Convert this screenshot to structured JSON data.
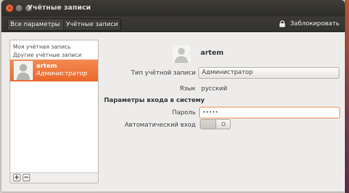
{
  "window": {
    "title": "Учётные записи"
  },
  "toolbar": {
    "breadcrumbs": [
      "Все параметры",
      "Учётные записи"
    ],
    "lock_label": "Заблокировать"
  },
  "accounts": {
    "headers": [
      "Моя учётная запись",
      "Другие учётные записи"
    ],
    "selected": {
      "name": "artem",
      "role": "Администратор"
    },
    "add_label": "+",
    "remove_label": "−"
  },
  "details": {
    "username": "artem",
    "account_type_label": "Тип учётной записи",
    "account_type_value": "Администратор",
    "language_label": "Язык",
    "language_value": "русский",
    "login_section": "Параметры входа в систему",
    "password_label": "Пароль",
    "password_value": "•••••",
    "autologin_label": "Автоматический вход",
    "autologin_state": "O"
  },
  "colors": {
    "accent": "#e9672a",
    "titlebar": "#3d3c37"
  }
}
